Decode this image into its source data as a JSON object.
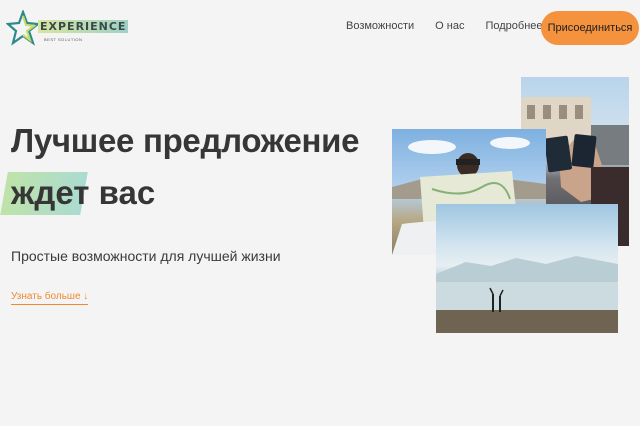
{
  "header": {
    "logo_title": "EXPERIENCE",
    "logo_sub": "BEST SOLUTION",
    "nav": [
      "Возможности",
      "О нас",
      "Подробнее"
    ],
    "join_label": "Присоединиться"
  },
  "hero": {
    "line1": "Лучшее предложение",
    "line2_highlight": "ждет",
    "line2_rest": "вас",
    "subtitle": "Простые возможности для лучшей жизни",
    "more_link": "Узнать больше ↓"
  },
  "colors": {
    "accent": "#f5923e",
    "highlight_start": "#bfe3a8",
    "highlight_end": "#aadbd2",
    "background": "#f4f4f4"
  },
  "images": [
    "passports-photo",
    "map-photo",
    "lake-photo"
  ]
}
